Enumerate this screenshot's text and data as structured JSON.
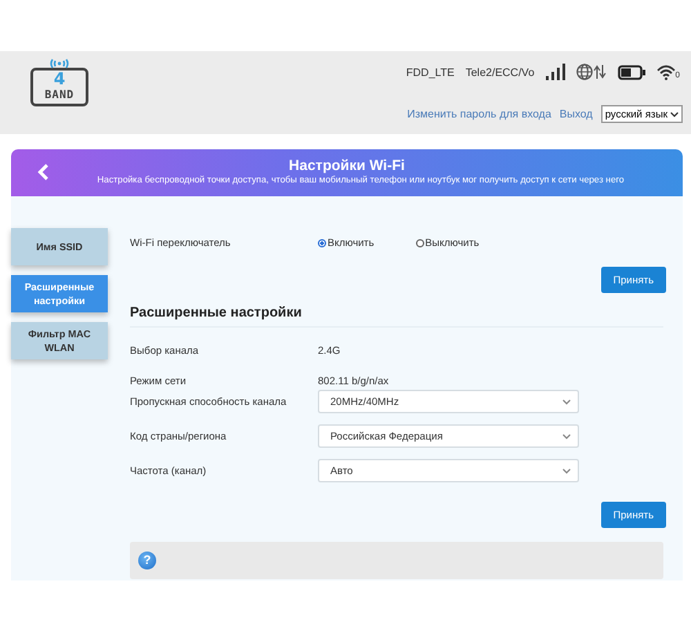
{
  "header": {
    "logo": {
      "digit": "4",
      "word": "BAND"
    },
    "network_type": "FDD_LTE",
    "operator": "Tele2/ECC/Vo",
    "wifi_clients": "0",
    "links": [
      "Изменить пароль для входа",
      "Выход"
    ],
    "language": "русский язык"
  },
  "banner": {
    "title": "Настройки Wi-Fi",
    "subtitle": "Настройка беспроводной точки доступа, чтобы ваш мобильный телефон или ноутбук мог получить доступ к сети через него"
  },
  "sidebar": {
    "items": [
      {
        "label": "Имя SSID",
        "selected": false
      },
      {
        "label": "Расширенные настройки",
        "selected": true
      },
      {
        "label": "Фильтр MAC WLAN",
        "selected": false
      }
    ]
  },
  "wifi_switch": {
    "label": "Wi-Fi переключатель",
    "options": [
      {
        "label": "Включить",
        "selected": true
      },
      {
        "label": "Выключить",
        "selected": false
      }
    ],
    "apply": "Принять"
  },
  "advanced": {
    "title": "Расширенные настройки",
    "rows": [
      {
        "kind": "text",
        "label": "Выбор канала",
        "value": "2.4G"
      },
      {
        "kind": "text",
        "label": "Режим сети",
        "value": "802.11 b/g/n/ax"
      },
      {
        "kind": "select",
        "label": "Пропускная способность канала",
        "value": "20MHz/40MHz"
      },
      {
        "kind": "select",
        "label": "Код страны/региона",
        "value": "Российская Федерация"
      },
      {
        "kind": "select",
        "label": "Частота (канал)",
        "value": "Авто"
      }
    ],
    "apply": "Принять"
  },
  "help": {
    "icon": "?"
  }
}
